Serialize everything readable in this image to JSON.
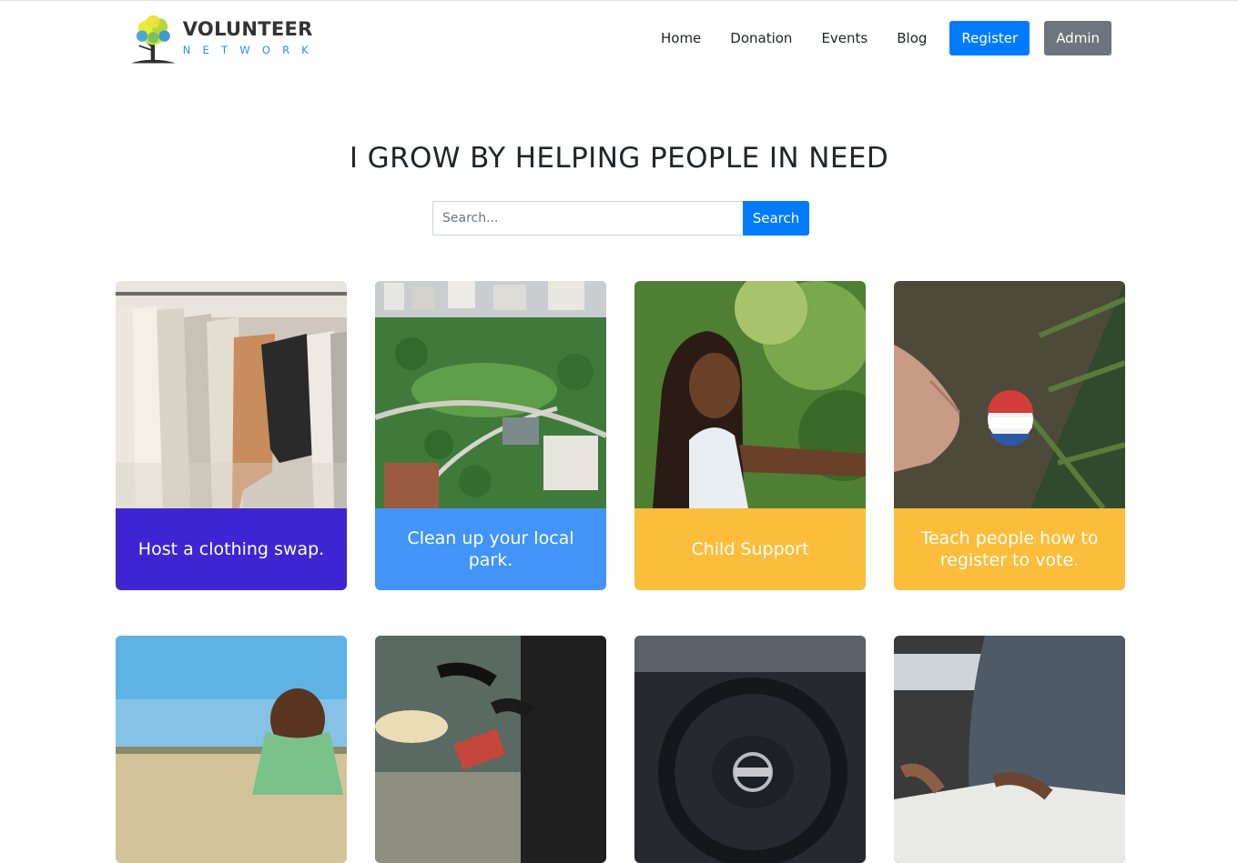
{
  "brand": {
    "title": "VOLUNTEER",
    "subtitle": "NETWORK"
  },
  "nav": {
    "links": [
      "Home",
      "Donation",
      "Events",
      "Blog"
    ],
    "register_label": "Register",
    "admin_label": "Admin"
  },
  "hero": {
    "title": "I GROW BY HELPING PEOPLE IN NEED",
    "search_placeholder": "Search...",
    "search_button": "Search"
  },
  "colors": {
    "primary": "#007bff",
    "secondary": "#6c757d",
    "card_purple": "#3f24d3",
    "card_blue": "#4294f7",
    "card_yellow": "#fbbd3a"
  },
  "cards": [
    {
      "title": "Host a clothing swap.",
      "color": "#3f24d3",
      "image": "clothing-rack-photo"
    },
    {
      "title": "Clean up your local park.",
      "color": "#4294f7",
      "image": "city-park-aerial-photo"
    },
    {
      "title": "Child Support",
      "color": "#fbbd3a",
      "image": "smiling-girl-photo"
    },
    {
      "title": "Teach people how to register to vote.",
      "color": "#fbbd3a",
      "image": "i-voted-sticker-photo",
      "sticker_text": "I VOTED"
    },
    {
      "title": "",
      "color": "",
      "image": "boy-in-field-photo"
    },
    {
      "title": "",
      "color": "",
      "image": "food-bank-photo"
    },
    {
      "title": "",
      "color": "",
      "image": "car-steering-wheel-photo"
    },
    {
      "title": "",
      "color": "",
      "image": "reading-book-photo"
    }
  ]
}
